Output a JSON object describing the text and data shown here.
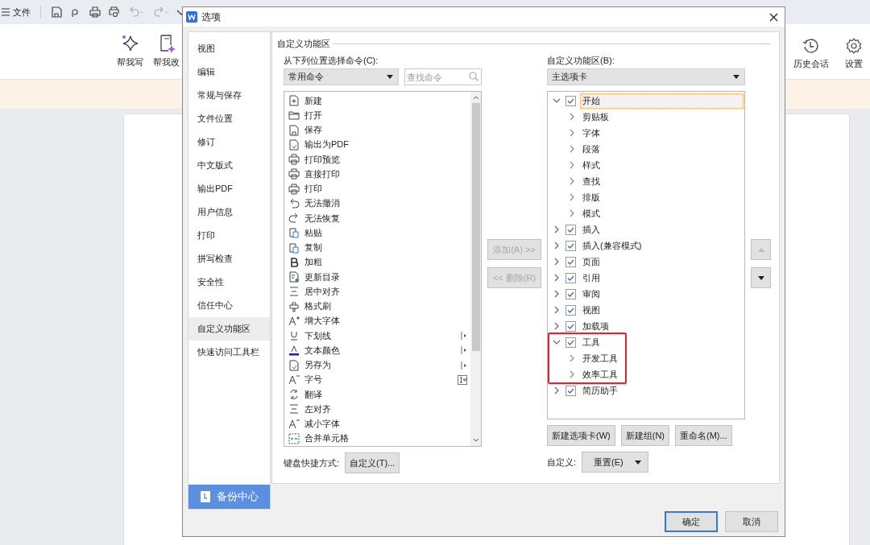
{
  "app": {
    "menu_label": "文件",
    "toolbar": [
      {
        "label": "帮我写"
      },
      {
        "label": "帮我改"
      },
      {
        "label": "历史会话"
      },
      {
        "label": "设置"
      }
    ]
  },
  "dialog": {
    "title": "选项",
    "nav": [
      {
        "label": "视图",
        "selected": false
      },
      {
        "label": "编辑",
        "selected": false
      },
      {
        "label": "常规与保存",
        "selected": false
      },
      {
        "label": "文件位置",
        "selected": false
      },
      {
        "label": "修订",
        "selected": false
      },
      {
        "label": "中文版式",
        "selected": false
      },
      {
        "label": "输出PDF",
        "selected": false
      },
      {
        "label": "用户信息",
        "selected": false
      },
      {
        "label": "打印",
        "selected": false
      },
      {
        "label": "拼写检查",
        "selected": false
      },
      {
        "label": "安全性",
        "selected": false
      },
      {
        "label": "信任中心",
        "selected": false
      },
      {
        "label": "自定义功能区",
        "selected": true
      },
      {
        "label": "快速访问工具栏",
        "selected": false
      }
    ],
    "backup_button": "备份中心",
    "section_title": "自定义功能区",
    "commands": {
      "label": "从下列位置选择命令(C):",
      "dropdown": "常用命令",
      "search_placeholder": "查找命令",
      "items": [
        {
          "label": "新建",
          "kind": "plain"
        },
        {
          "label": "打开",
          "kind": "plain"
        },
        {
          "label": "保存",
          "kind": "plain"
        },
        {
          "label": "输出为PDF",
          "kind": "plain"
        },
        {
          "label": "打印预览",
          "kind": "plain"
        },
        {
          "label": "直接打印",
          "kind": "plain"
        },
        {
          "label": "打印",
          "kind": "plain"
        },
        {
          "label": "无法撤消",
          "kind": "plain"
        },
        {
          "label": "无法恢复",
          "kind": "plain"
        },
        {
          "label": "粘贴",
          "kind": "plain"
        },
        {
          "label": "复制",
          "kind": "plain"
        },
        {
          "label": "加粗",
          "kind": "plain"
        },
        {
          "label": "更新目录",
          "kind": "plain"
        },
        {
          "label": "居中对齐",
          "kind": "plain"
        },
        {
          "label": "格式刷",
          "kind": "plain"
        },
        {
          "label": "增大字体",
          "kind": "plain"
        },
        {
          "label": "下划线",
          "kind": "submenu"
        },
        {
          "label": "文本颜色",
          "kind": "submenu"
        },
        {
          "label": "另存为",
          "kind": "submenu"
        },
        {
          "label": "字号",
          "kind": "dropdown"
        },
        {
          "label": "翻译",
          "kind": "plain"
        },
        {
          "label": "左对齐",
          "kind": "plain"
        },
        {
          "label": "减小字体",
          "kind": "plain"
        },
        {
          "label": "合并单元格",
          "kind": "plain"
        }
      ]
    },
    "add_button": {
      "label": "添加(A) >>",
      "disabled": true
    },
    "remove_button": {
      "label": "<< 删除(R)",
      "disabled": true
    },
    "ribbon": {
      "label": "自定义功能区(B):",
      "dropdown": "主选项卡",
      "tree": [
        {
          "label": "开始",
          "checked": true,
          "expanded": true,
          "selected": true,
          "highlighted": false,
          "children": [
            {
              "label": "剪贴板",
              "expanded": false
            },
            {
              "label": "字体",
              "expanded": false
            },
            {
              "label": "段落",
              "expanded": false
            },
            {
              "label": "样式",
              "expanded": false
            },
            {
              "label": "查找",
              "expanded": false
            },
            {
              "label": "排版",
              "expanded": false
            },
            {
              "label": "模式",
              "expanded": false
            }
          ]
        },
        {
          "label": "插入",
          "checked": true,
          "expanded": false,
          "selected": false,
          "highlighted": false
        },
        {
          "label": "插入(兼容模式)",
          "checked": true,
          "expanded": false,
          "selected": false,
          "highlighted": false
        },
        {
          "label": "页面",
          "checked": true,
          "expanded": false,
          "selected": false,
          "highlighted": false
        },
        {
          "label": "引用",
          "checked": true,
          "expanded": false,
          "selected": false,
          "highlighted": false
        },
        {
          "label": "审阅",
          "checked": true,
          "expanded": false,
          "selected": false,
          "highlighted": false
        },
        {
          "label": "视图",
          "checked": true,
          "expanded": false,
          "selected": false,
          "highlighted": false
        },
        {
          "label": "加载项",
          "checked": true,
          "expanded": false,
          "selected": false,
          "highlighted": false
        },
        {
          "label": "工具",
          "checked": true,
          "expanded": true,
          "selected": false,
          "highlighted": true,
          "children": [
            {
              "label": "开发工具",
              "expanded": false
            },
            {
              "label": "效率工具",
              "expanded": false
            }
          ]
        },
        {
          "label": "简历助手",
          "checked": true,
          "expanded": false,
          "selected": false,
          "highlighted": false
        }
      ]
    },
    "move_up": {
      "disabled": true
    },
    "move_down": {
      "disabled": false
    },
    "tree_buttons": [
      "新建选项卡(W)",
      "新建组(N)",
      "重命名(M)..."
    ],
    "keyboard": {
      "label": "键盘快捷方式:",
      "button": "自定义(T)..."
    },
    "customize": {
      "label": "自定义:",
      "button": "重置(E)"
    },
    "ok": "确定",
    "cancel": "取消"
  }
}
